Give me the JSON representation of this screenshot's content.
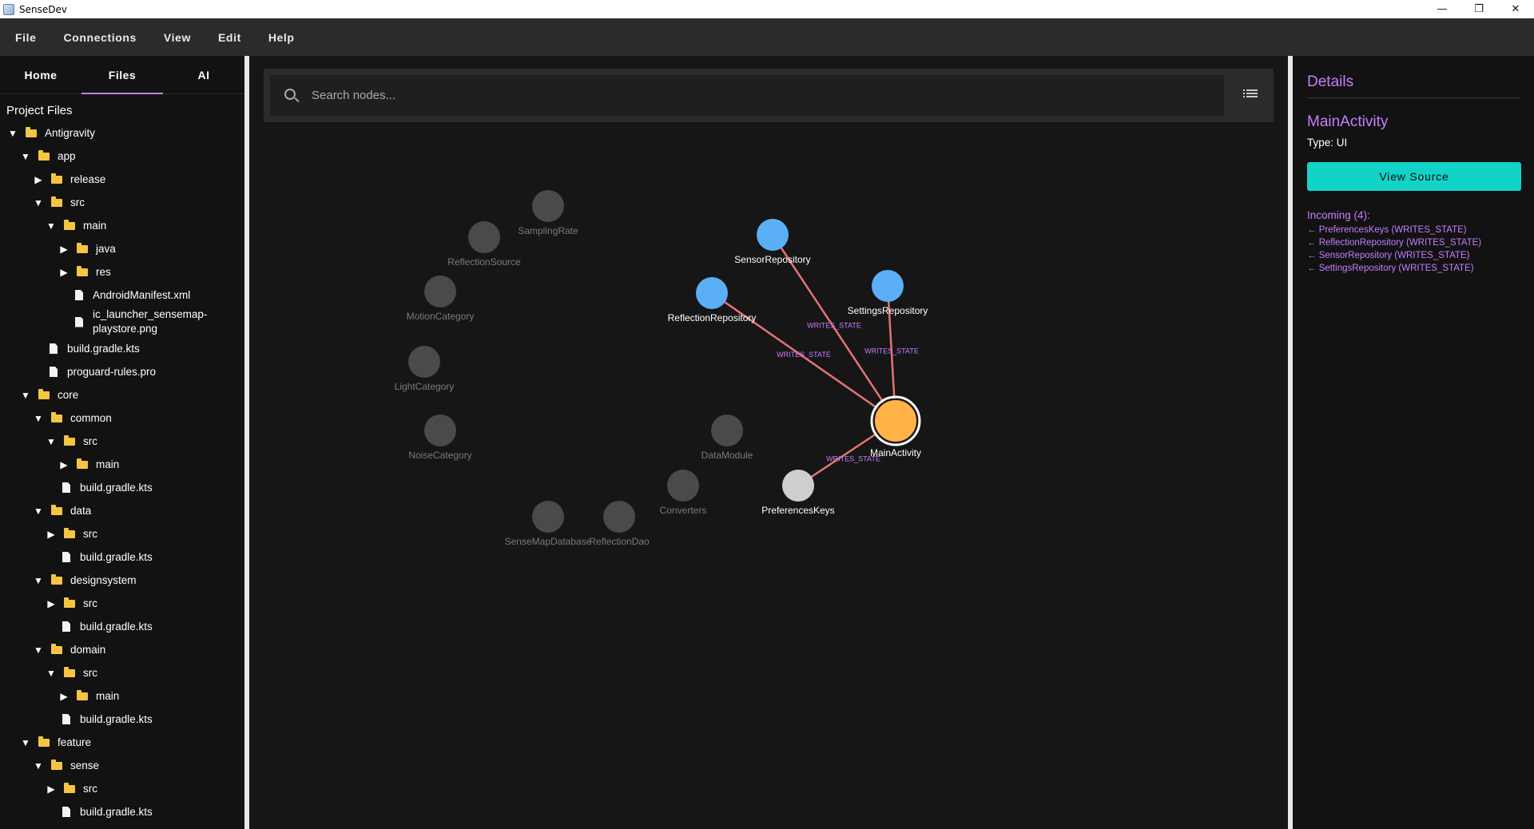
{
  "window": {
    "title": "SenseDev",
    "controls": {
      "minimize": "—",
      "restore": "❐",
      "close": "✕"
    }
  },
  "menu": [
    "File",
    "Connections",
    "View",
    "Edit",
    "Help"
  ],
  "left_tabs": {
    "items": [
      "Home",
      "Files",
      "AI"
    ],
    "active": "Files"
  },
  "project_files_title": "Project Files",
  "tree": [
    {
      "label": "Antigravity",
      "type": "folder",
      "depth": 0,
      "expanded": true
    },
    {
      "label": "app",
      "type": "folder",
      "depth": 1,
      "expanded": true
    },
    {
      "label": "release",
      "type": "folder",
      "depth": 2,
      "expanded": false
    },
    {
      "label": "src",
      "type": "folder",
      "depth": 2,
      "expanded": true
    },
    {
      "label": "main",
      "type": "folder",
      "depth": 3,
      "expanded": true
    },
    {
      "label": "java",
      "type": "folder",
      "depth": 4,
      "expanded": false
    },
    {
      "label": "res",
      "type": "folder",
      "depth": 4,
      "expanded": false
    },
    {
      "label": "AndroidManifest.xml",
      "type": "file",
      "depth": 4
    },
    {
      "label": "ic_launcher_sensemap-playstore.png",
      "type": "file",
      "depth": 4,
      "wrap": true
    },
    {
      "label": "build.gradle.kts",
      "type": "file",
      "depth": 2
    },
    {
      "label": "proguard-rules.pro",
      "type": "file",
      "depth": 2
    },
    {
      "label": "core",
      "type": "folder",
      "depth": 1,
      "expanded": true
    },
    {
      "label": "common",
      "type": "folder",
      "depth": 2,
      "expanded": true
    },
    {
      "label": "src",
      "type": "folder",
      "depth": 3,
      "expanded": true
    },
    {
      "label": "main",
      "type": "folder",
      "depth": 4,
      "expanded": false
    },
    {
      "label": "build.gradle.kts",
      "type": "file",
      "depth": 3
    },
    {
      "label": "data",
      "type": "folder",
      "depth": 2,
      "expanded": true
    },
    {
      "label": "src",
      "type": "folder",
      "depth": 3,
      "expanded": false
    },
    {
      "label": "build.gradle.kts",
      "type": "file",
      "depth": 3
    },
    {
      "label": "designsystem",
      "type": "folder",
      "depth": 2,
      "expanded": true
    },
    {
      "label": "src",
      "type": "folder",
      "depth": 3,
      "expanded": false
    },
    {
      "label": "build.gradle.kts",
      "type": "file",
      "depth": 3
    },
    {
      "label": "domain",
      "type": "folder",
      "depth": 2,
      "expanded": true
    },
    {
      "label": "src",
      "type": "folder",
      "depth": 3,
      "expanded": true
    },
    {
      "label": "main",
      "type": "folder",
      "depth": 4,
      "expanded": false
    },
    {
      "label": "build.gradle.kts",
      "type": "file",
      "depth": 3
    },
    {
      "label": "feature",
      "type": "folder",
      "depth": 1,
      "expanded": true
    },
    {
      "label": "sense",
      "type": "folder",
      "depth": 2,
      "expanded": true
    },
    {
      "label": "src",
      "type": "folder",
      "depth": 3,
      "expanded": false
    },
    {
      "label": "build.gradle.kts",
      "type": "file",
      "depth": 3
    }
  ],
  "search": {
    "placeholder": "Search nodes..."
  },
  "graph": {
    "colors": {
      "faded_node": "#4a4a4a",
      "faded_label": "#7a7a7a",
      "repository": "#5aaff5",
      "selected": "#ffb347",
      "edge": "#e57373",
      "edge_label": "#c77dff",
      "prefs": "#cfcfcf"
    },
    "nodes": [
      {
        "id": "SamplingRate",
        "label": "SamplingRate",
        "kind": "faded"
      },
      {
        "id": "ReflectionSource",
        "label": "ReflectionSource",
        "kind": "faded"
      },
      {
        "id": "MotionCategory",
        "label": "MotionCategory",
        "kind": "faded"
      },
      {
        "id": "LightCategory",
        "label": "LightCategory",
        "kind": "faded"
      },
      {
        "id": "NoiseCategory",
        "label": "NoiseCategory",
        "kind": "faded"
      },
      {
        "id": "DataModule",
        "label": "DataModule",
        "kind": "faded"
      },
      {
        "id": "Converters",
        "label": "Converters",
        "kind": "faded"
      },
      {
        "id": "SenseMapDatabase",
        "label": "SenseMapDatabase",
        "kind": "faded"
      },
      {
        "id": "ReflectionDao",
        "label": "ReflectionDao",
        "kind": "faded"
      },
      {
        "id": "SensorRepository",
        "label": "SensorRepository",
        "kind": "repository"
      },
      {
        "id": "ReflectionRepository",
        "label": "ReflectionRepository",
        "kind": "repository"
      },
      {
        "id": "SettingsRepository",
        "label": "SettingsRepository",
        "kind": "repository"
      },
      {
        "id": "PreferencesKeys",
        "label": "PreferencesKeys",
        "kind": "prefs"
      },
      {
        "id": "MainActivity",
        "label": "MainActivity",
        "kind": "selected"
      }
    ],
    "edges": [
      {
        "from": "SensorRepository",
        "to": "MainActivity",
        "label": "WRITES_STATE"
      },
      {
        "from": "ReflectionRepository",
        "to": "MainActivity",
        "label": "WRITES_STATE"
      },
      {
        "from": "SettingsRepository",
        "to": "MainActivity",
        "label": "WRITES_STATE"
      },
      {
        "from": "PreferencesKeys",
        "to": "MainActivity",
        "label": "WRITES_STATE"
      }
    ]
  },
  "details": {
    "title": "Details",
    "node_name": "MainActivity",
    "node_type": "Type: UI",
    "view_source_label": "View Source",
    "incoming_title": "Incoming (4):",
    "incoming": [
      "← PreferencesKeys (WRITES_STATE)",
      "← ReflectionRepository (WRITES_STATE)",
      "← SensorRepository (WRITES_STATE)",
      "← SettingsRepository (WRITES_STATE)"
    ]
  }
}
